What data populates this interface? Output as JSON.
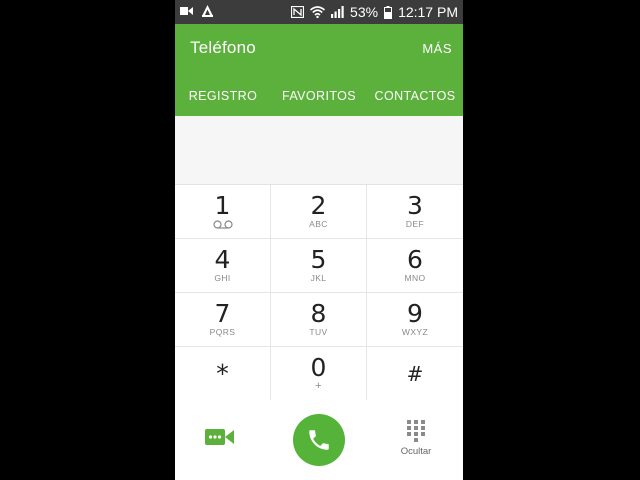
{
  "status_bar": {
    "battery_percent": "53%",
    "time": "12:17 PM",
    "icons": [
      "video-camera-icon",
      "notification-a-icon",
      "nfc-icon",
      "wifi-icon",
      "cell-signal-icon",
      "battery-icon"
    ]
  },
  "app_bar": {
    "title": "Teléfono",
    "more_label": "MÁS",
    "tabs": [
      {
        "label": "REGISTRO"
      },
      {
        "label": "FAVORITOS"
      },
      {
        "label": "CONTACTOS"
      }
    ]
  },
  "keypad": {
    "keys": [
      {
        "digit": "1",
        "letters": "",
        "icon": "voicemail-icon"
      },
      {
        "digit": "2",
        "letters": "ABC"
      },
      {
        "digit": "3",
        "letters": "DEF"
      },
      {
        "digit": "4",
        "letters": "GHI"
      },
      {
        "digit": "5",
        "letters": "JKL"
      },
      {
        "digit": "6",
        "letters": "MNO"
      },
      {
        "digit": "7",
        "letters": "PQRS"
      },
      {
        "digit": "8",
        "letters": "TUV"
      },
      {
        "digit": "9",
        "letters": "WXYZ"
      },
      {
        "digit": "*",
        "letters": ""
      },
      {
        "digit": "0",
        "letters": "+"
      },
      {
        "digit": "#",
        "letters": ""
      }
    ]
  },
  "bottom_bar": {
    "hide_label": "Ocultar",
    "icons": [
      "video-call-icon",
      "phone-icon",
      "dialpad-icon"
    ]
  },
  "colors": {
    "accent_green": "#5cb13c",
    "call_green": "#56b33a",
    "status_bar": "#3c3c3c",
    "background": "#f3f3f3"
  }
}
